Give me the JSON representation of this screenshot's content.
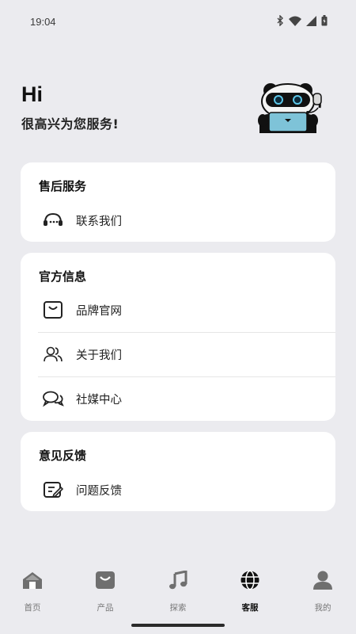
{
  "status": {
    "time": "19:04",
    "icons": [
      "bluetooth-icon",
      "wifi-icon",
      "signal-icon",
      "battery-icon"
    ]
  },
  "hero": {
    "greeting": "Hi",
    "subtitle": "很高兴为您服务!"
  },
  "after_sales": {
    "title": "售后服务",
    "items": [
      {
        "label": "联系我们",
        "icon": "headset-icon"
      }
    ]
  },
  "official": {
    "title": "官方信息",
    "items": [
      {
        "label": "品牌官网",
        "icon": "shopping-bag-icon"
      },
      {
        "label": "关于我们",
        "icon": "users-icon"
      },
      {
        "label": "社媒中心",
        "icon": "chat-bubbles-icon"
      }
    ]
  },
  "feedback": {
    "title": "意见反馈",
    "items": [
      {
        "label": "问题反馈",
        "icon": "feedback-edit-icon"
      }
    ]
  },
  "tabs": [
    {
      "label": "首页",
      "icon": "home-icon",
      "active": false
    },
    {
      "label": "产品",
      "icon": "bag-icon",
      "active": false
    },
    {
      "label": "探索",
      "icon": "music-note-icon",
      "active": false
    },
    {
      "label": "客服",
      "icon": "globe-icon",
      "active": true
    },
    {
      "label": "我的",
      "icon": "person-icon",
      "active": false
    }
  ],
  "colors": {
    "background": "#ebebef",
    "card": "#ffffff",
    "mascot_screen": "#7ec3d8",
    "active_tab": "#111111",
    "inactive_tab": "#777777"
  }
}
